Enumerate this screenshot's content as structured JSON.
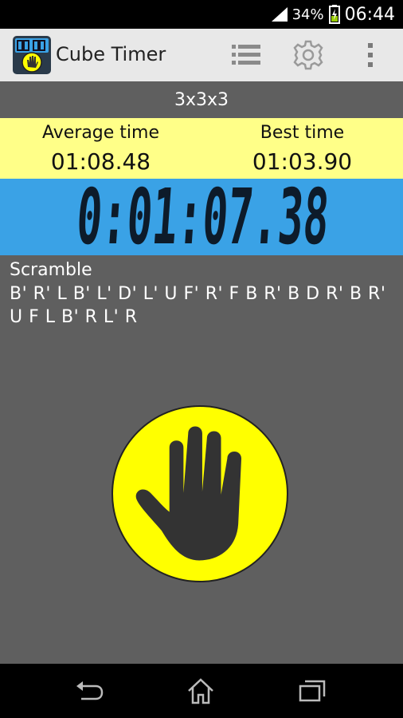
{
  "status_bar": {
    "battery_percent": "34%",
    "time": "06:44"
  },
  "action_bar": {
    "app_title": "Cube Timer",
    "app_icon": "cube-timer-app-icon",
    "actions": [
      "list-icon",
      "gear-icon",
      "overflow-menu-icon"
    ]
  },
  "puzzle": {
    "name": "3x3x3"
  },
  "stats": {
    "average_label": "Average time",
    "average_value": "01:08.48",
    "best_label": "Best time",
    "best_value": "01:03.90"
  },
  "timer": {
    "display": "0:01:07.38"
  },
  "scramble": {
    "title": "Scramble",
    "moves": "B' R' L B' L' D' L' U F' R' F B R' B D R' B R' U F L B' R L' R"
  },
  "start_button": {
    "icon": "hand-icon"
  },
  "nav_bar": {
    "buttons": [
      "back-icon",
      "home-icon",
      "recent-apps-icon"
    ]
  },
  "colors": {
    "stats_background": "#ffff88",
    "timer_background": "#3aa2e6",
    "start_button": "#ffff00",
    "body_background": "#5f5f5f"
  }
}
